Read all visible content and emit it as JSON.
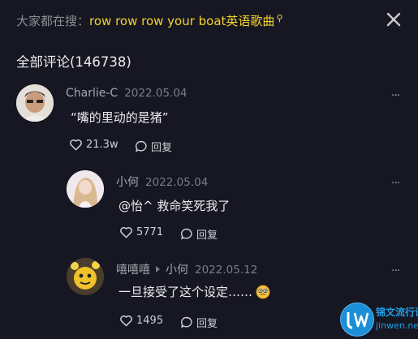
{
  "search": {
    "prefix": "大家都在搜：",
    "term": "row row row your boat英语歌曲",
    "search_glyph": "⚲"
  },
  "comments_header": "全部评论(146738)",
  "comments": [
    {
      "username": "Charlie-C",
      "date": "2022.05.04",
      "text": "“嘴的里动的是猪”",
      "likes": "21.3w",
      "reply_label": "回复",
      "more": "···"
    },
    {
      "username": "小何",
      "date": "2022.05.04",
      "text": "@怡^ 救命笑死我了",
      "likes": "5771",
      "reply_label": "回复",
      "more": "···"
    },
    {
      "username": "嘻嘻嘻",
      "reply_to": "小何",
      "date": "2022.05.12",
      "text": "一旦接受了这个设定……",
      "likes": "1495",
      "reply_label": "回复",
      "more": "···"
    }
  ],
  "watermark": {
    "name": "锦文流行语",
    "url": "jinwen.net"
  },
  "colors": {
    "background": "#161722",
    "accent": "#f6d32b",
    "muted": "#8d8e94"
  }
}
